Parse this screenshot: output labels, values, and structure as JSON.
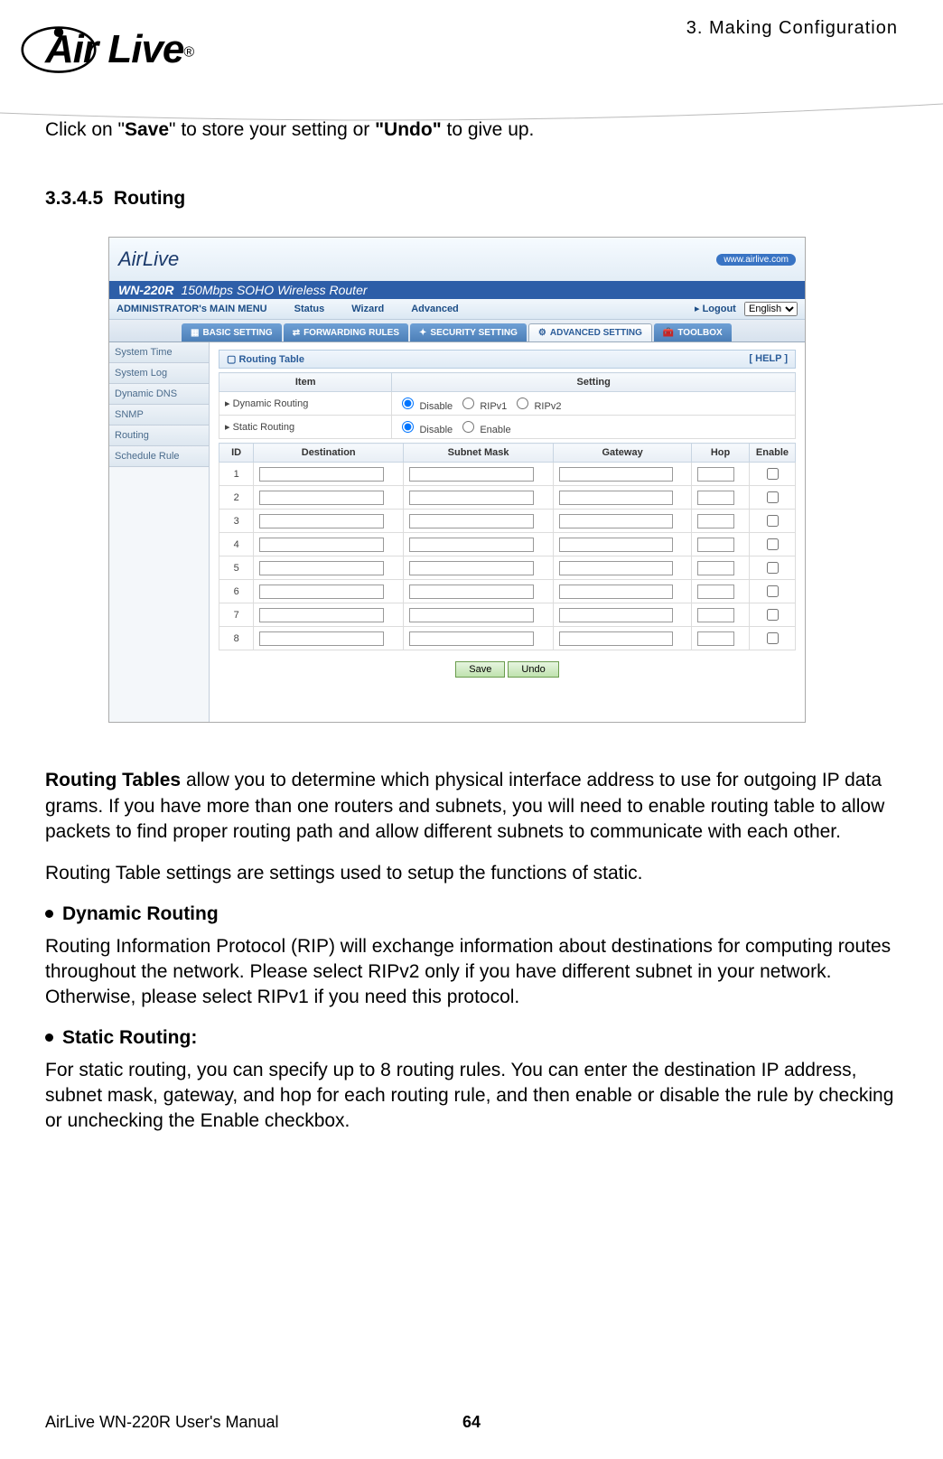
{
  "chapter": "3. Making Configuration",
  "logo": "Air Live",
  "intro_before": "Click on \"",
  "intro_save": "Save",
  "intro_mid": "\" to store your setting or ",
  "intro_undo": "\"Undo\"",
  "intro_after": " to give up.",
  "section_num": "3.3.4.5",
  "section_title": "Routing",
  "ss": {
    "logo": "AirLive",
    "model": "WN-220R",
    "model_sub": "150Mbps SOHO Wireless Router",
    "url": "www.airlive.com",
    "admin": "ADMINISTRATOR's MAIN MENU",
    "menu": [
      "Status",
      "Wizard",
      "Advanced"
    ],
    "logout": "Logout",
    "lang": "English",
    "tabs": [
      "BASIC SETTING",
      "FORWARDING RULES",
      "SECURITY SETTING",
      "ADVANCED SETTING",
      "TOOLBOX"
    ],
    "side": [
      "System Time",
      "System Log",
      "Dynamic DNS",
      "SNMP",
      "Routing",
      "Schedule Rule"
    ],
    "panel": "Routing Table",
    "help": "[ HELP ]",
    "th_item": "Item",
    "th_setting": "Setting",
    "dyn_label": "Dynamic Routing",
    "dyn_opts": [
      "Disable",
      "RIPv1",
      "RIPv2"
    ],
    "stat_label": "Static Routing",
    "stat_opts": [
      "Disable",
      "Enable"
    ],
    "cols": [
      "ID",
      "Destination",
      "Subnet Mask",
      "Gateway",
      "Hop",
      "Enable"
    ],
    "rows": [
      1,
      2,
      3,
      4,
      5,
      6,
      7,
      8
    ],
    "save": "Save",
    "undo": "Undo"
  },
  "p1_lead": "Routing Tables",
  "p1_rest": " allow you to determine which physical interface address to use for outgoing IP data grams. If you have more than one routers and subnets, you will need to enable routing table to allow packets to find proper routing path and allow different subnets to communicate with each other.",
  "p2": "Routing Table settings are settings used to setup the functions of static.",
  "b1": "Dynamic Routing",
  "p3": "Routing Information Protocol (RIP) will exchange information about destinations for computing routes throughout the network. Please select RIPv2 only if you have different subnet in your network.",
  "p3b": "Otherwise, please select RIPv1 if you need this protocol.",
  "b2": "Static Routing:",
  "p4": "For static routing, you can specify up to 8 routing rules. You can enter the destination IP address, subnet mask, gateway, and hop for each routing rule, and then enable or disable the rule by checking or unchecking the Enable checkbox.",
  "footer_left": "AirLive WN-220R User's Manual",
  "footer_page": "64"
}
